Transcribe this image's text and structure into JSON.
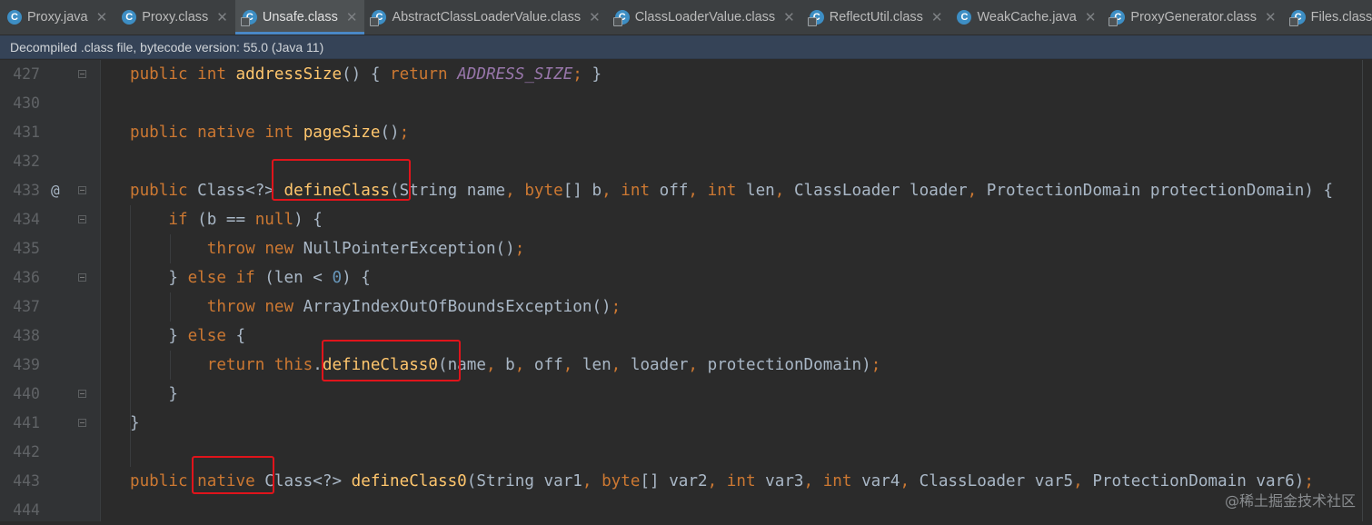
{
  "tabs": [
    {
      "label": "Proxy.java",
      "icon": "class-icon",
      "icon_char": "C",
      "compiled": false,
      "active": false
    },
    {
      "label": "Proxy.class",
      "icon": "class-icon",
      "icon_char": "C",
      "compiled": false,
      "active": false
    },
    {
      "label": "Unsafe.class",
      "icon": "compiled-class-icon",
      "icon_char": "C",
      "compiled": true,
      "active": true
    },
    {
      "label": "AbstractClassLoaderValue.class",
      "icon": "compiled-class-icon",
      "icon_char": "C",
      "compiled": true,
      "active": false
    },
    {
      "label": "ClassLoaderValue.class",
      "icon": "compiled-class-icon",
      "icon_char": "C",
      "compiled": true,
      "active": false
    },
    {
      "label": "ReflectUtil.class",
      "icon": "compiled-class-icon",
      "icon_char": "C",
      "compiled": true,
      "active": false
    },
    {
      "label": "WeakCache.java",
      "icon": "class-icon",
      "icon_char": "C",
      "compiled": false,
      "active": false
    },
    {
      "label": "ProxyGenerator.class",
      "icon": "compiled-class-icon",
      "icon_char": "C",
      "compiled": true,
      "active": false
    },
    {
      "label": "Files.class",
      "icon": "compiled-class-icon",
      "icon_char": "C",
      "compiled": true,
      "active": false
    }
  ],
  "banner": {
    "text": "Decompiled .class file, bytecode version: 55.0 (Java 11)"
  },
  "lines": [
    {
      "n": "427",
      "at": "",
      "fold": true,
      "code": "public int addressSize() { return ADDRESS_SIZE; }"
    },
    {
      "n": "430",
      "at": "",
      "fold": false,
      "code": ""
    },
    {
      "n": "431",
      "at": "",
      "fold": false,
      "code": "public native int pageSize();"
    },
    {
      "n": "432",
      "at": "",
      "fold": false,
      "code": ""
    },
    {
      "n": "433",
      "at": "@",
      "fold": true,
      "code": "public Class<?> defineClass(String name, byte[] b, int off, int len, ClassLoader loader, ProtectionDomain protectionDomain) {"
    },
    {
      "n": "434",
      "at": "",
      "fold": true,
      "code": "    if (b == null) {"
    },
    {
      "n": "435",
      "at": "",
      "fold": false,
      "code": "        throw new NullPointerException();"
    },
    {
      "n": "436",
      "at": "",
      "fold": true,
      "code": "    } else if (len < 0) {"
    },
    {
      "n": "437",
      "at": "",
      "fold": false,
      "code": "        throw new ArrayIndexOutOfBoundsException();"
    },
    {
      "n": "438",
      "at": "",
      "fold": false,
      "code": "    } else {"
    },
    {
      "n": "439",
      "at": "",
      "fold": false,
      "code": "        return this.defineClass0(name, b, off, len, loader, protectionDomain);"
    },
    {
      "n": "440",
      "at": "",
      "fold": true,
      "code": "    }"
    },
    {
      "n": "441",
      "at": "",
      "fold": true,
      "code": "}"
    },
    {
      "n": "442",
      "at": "",
      "fold": false,
      "code": ""
    },
    {
      "n": "443",
      "at": "",
      "fold": false,
      "code": "public native Class<?> defineClass0(String var1, byte[] var2, int var3, int var4, ClassLoader var5, ProtectionDomain var6);"
    },
    {
      "n": "444",
      "at": "",
      "fold": false,
      "code": ""
    }
  ],
  "watermark": "@稀土掘金技术社区"
}
